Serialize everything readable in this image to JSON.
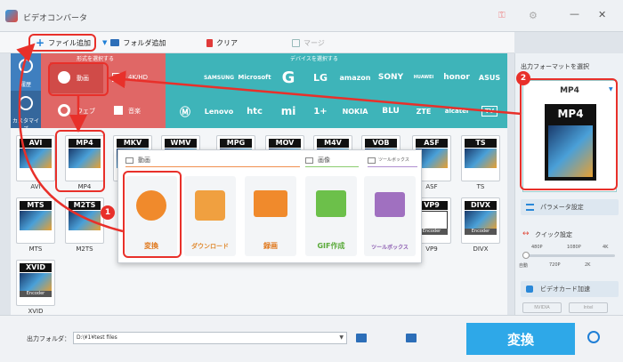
{
  "window": {
    "title": "ビデオコンバータ"
  },
  "toolbar": {
    "add_file": "ファイル追加",
    "add_folder": "フォルダ追加",
    "clear": "クリア",
    "merge": "マージ"
  },
  "category_bar": {
    "format_header": "形式を選択する",
    "device_header": "デバイスを選択する",
    "side_items": [
      "履歴",
      "カスタマイズ"
    ],
    "format_tabs": [
      "動画",
      "4K/HD",
      "ウェブ",
      "音楽"
    ],
    "brands": [
      "apple",
      "SAMSUNG",
      "Microsoft",
      "G",
      "LG",
      "amazon",
      "SONY",
      "HUAWEI",
      "honor",
      "ASUS",
      "motorola",
      "Lenovo",
      "htc",
      "mi",
      "1+",
      "NOKIA",
      "BLU",
      "ZTE",
      "alcatel",
      "TV"
    ]
  },
  "formats": [
    {
      "top": "AVI",
      "label": "AVI"
    },
    {
      "top": "MP4",
      "label": "MP4"
    },
    {
      "top": "MKV",
      "label": "MKV"
    },
    {
      "top": "WMV",
      "label": "WMV"
    },
    {
      "top": "MPG",
      "label": "MPG"
    },
    {
      "top": "MOV",
      "label": "MOV"
    },
    {
      "top": "M4V",
      "label": "M4V"
    },
    {
      "top": "VOB",
      "label": "VOB"
    },
    {
      "top": "ASF",
      "label": "ASF"
    },
    {
      "top": "TS",
      "label": "TS"
    },
    {
      "top": "MTS",
      "label": "MTS"
    },
    {
      "top": "M2TS",
      "label": "M2TS"
    },
    {
      "top": "VP9",
      "label": "VP9"
    },
    {
      "top": "DIVX",
      "label": "DIVX"
    },
    {
      "top": "XVID",
      "label": "XVID"
    }
  ],
  "popup": {
    "tabs": [
      "動画",
      "画像",
      "ツールボックス"
    ],
    "tools": [
      {
        "label": "変換",
        "color": "#f08a2c",
        "icon": "film-icon"
      },
      {
        "label": "ダウンロード",
        "color": "#f0a040",
        "icon": "download-icon"
      },
      {
        "label": "録画",
        "color": "#f08a2c",
        "icon": "screen-record-icon"
      },
      {
        "label": "GIF作成",
        "color": "#6cc04a",
        "icon": "image-icon"
      },
      {
        "label": "ツールボックス",
        "color": "#a070c0",
        "icon": "toolbox-icon"
      }
    ]
  },
  "right_panel": {
    "output_label": "出力フォーマットを選択",
    "selected_format": "MP4",
    "param_button": "パラメータ設定",
    "quick_settings": "クイック設定",
    "quality_top": [
      "480P",
      "1080P",
      "4K"
    ],
    "quality_bottom": [
      "自動",
      "720P",
      "2K"
    ],
    "hw_accel": "ビデオカード加速",
    "gpu": [
      "NVIDIA",
      "Intel"
    ]
  },
  "bottom": {
    "output_folder_label": "出力フォルダ：",
    "output_folder_value": "D:\\¥1¥test files",
    "convert_button": "変換"
  },
  "annotations": {
    "badge1": "1",
    "badge2": "2"
  },
  "colors": {
    "accent": "#2ea8e8",
    "annotation": "#e8302a"
  }
}
